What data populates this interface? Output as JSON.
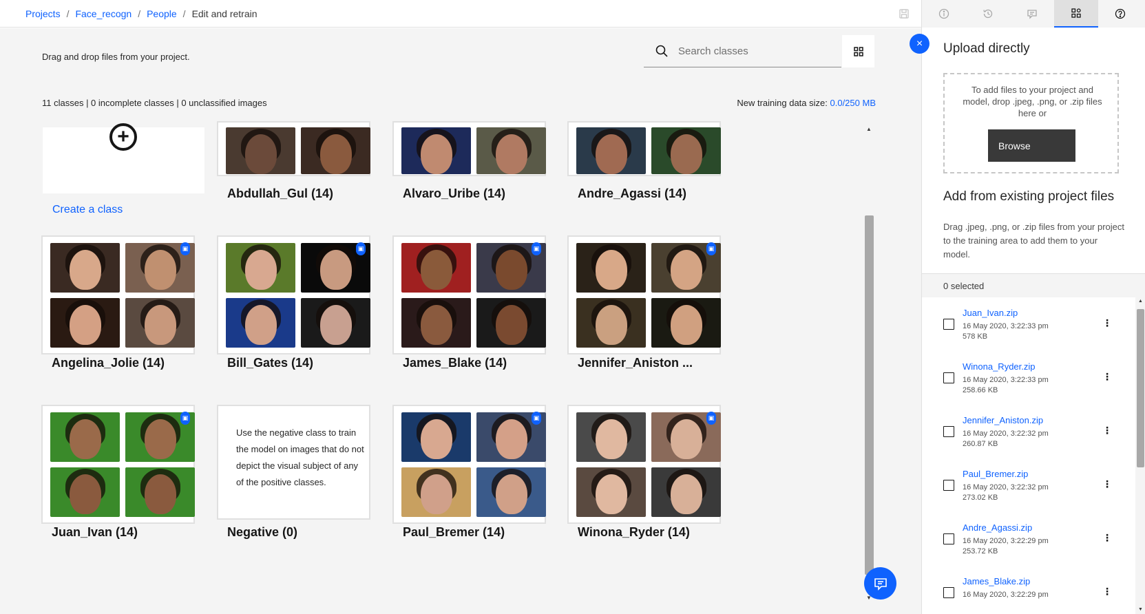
{
  "breadcrumb": {
    "items": [
      "Projects",
      "Face_recogn",
      "People"
    ],
    "separator": "/",
    "current": "Edit and retrain"
  },
  "toolbar": {
    "drag_hint": "Drag and drop files from your project.",
    "search_placeholder": "Search classes",
    "stats": "11 classes | 0 incomplete classes | 0 unclassified images",
    "datasize_label": "New training data size:",
    "datasize_value": "0.0/250 MB"
  },
  "create_class": {
    "label": "Create a class"
  },
  "classes": [
    {
      "label": "Abdullah_Gul (14)",
      "locked": false,
      "tones": [
        "#6b4a3a",
        "#8a5a3e"
      ],
      "bg": [
        "#4a3a30",
        "#3b2a22"
      ]
    },
    {
      "label": "Alvaro_Uribe (14)",
      "locked": false,
      "tones": [
        "#c08a70",
        "#b07a62"
      ],
      "bg": [
        "#1d2a5a",
        "#5a5a48"
      ]
    },
    {
      "label": "Andre_Agassi (14)",
      "locked": false,
      "tones": [
        "#a06a52",
        "#9a6a50"
      ],
      "bg": [
        "#2a3a4a",
        "#2a4a2a"
      ]
    },
    {
      "label": "Angelina_Jolie (14)",
      "locked": true,
      "tones": [
        "#d8a88a",
        "#c09070",
        "#d4a084",
        "#c8987c"
      ],
      "bg": [
        "#3a2a22",
        "#7a6050",
        "#2a1a12",
        "#5a4a40"
      ]
    },
    {
      "label": "Bill_Gates (14)",
      "locked": true,
      "tones": [
        "#d8a890",
        "#c89a80",
        "#d0a088",
        "#c8a090"
      ],
      "bg": [
        "#5a7a2a",
        "#0a0a0a",
        "#1a3a8a",
        "#1a1a1a"
      ]
    },
    {
      "label": "James_Blake (14)",
      "locked": true,
      "tones": [
        "#8a5a3a",
        "#7a4a2e",
        "#8a5a3e",
        "#7a4a30"
      ],
      "bg": [
        "#a02020",
        "#3a3a4a",
        "#2a1a1a",
        "#1a1a1a"
      ]
    },
    {
      "label": "Jennifer_Aniston ...",
      "locked": true,
      "tones": [
        "#d8a888",
        "#d4a484",
        "#caa080",
        "#d0a080"
      ],
      "bg": [
        "#2a2218",
        "#4a4030",
        "#3a3020",
        "#1a1a12"
      ]
    },
    {
      "label": "Juan_Ivan (14)",
      "locked": true,
      "tones": [
        "#9a6a4a",
        "#9a6a4a",
        "#8a5a3e",
        "#8a5a3e"
      ],
      "bg": [
        "#3a8a2a",
        "#3a8a2a",
        "#3a8a2a",
        "#3a8a2a"
      ]
    },
    {
      "label": "Negative (0)",
      "negative": true,
      "text": "Use the negative class to train the model on images that do not depict the visual subject of any of the positive classes."
    },
    {
      "label": "Paul_Bremer (14)",
      "locked": true,
      "tones": [
        "#d8a890",
        "#d4a088",
        "#d0a08a",
        "#d0a088"
      ],
      "bg": [
        "#1a3a6a",
        "#3a4a6a",
        "#c8a060",
        "#3a5a8a"
      ]
    },
    {
      "label": "Winona_Ryder (14)",
      "locked": true,
      "tones": [
        "#e0b8a0",
        "#d8b098",
        "#e0b8a0",
        "#d8b098"
      ],
      "bg": [
        "#4a4a4a",
        "#8a6a5a",
        "#5a4a40",
        "#3a3a3a"
      ]
    }
  ],
  "right_tabs": [
    {
      "icon": "info-icon",
      "active": false
    },
    {
      "icon": "history-icon",
      "active": false
    },
    {
      "icon": "comment-icon",
      "active": false
    },
    {
      "icon": "data-icon",
      "active": true
    },
    {
      "icon": "help-icon",
      "active": false
    }
  ],
  "panel": {
    "close_icon": "×",
    "upload_title": "Upload directly",
    "drop_text": "To add files to your project and model, drop .jpeg, .png, or .zip files here or",
    "browse_label": "Browse",
    "existing_title": "Add from existing project files",
    "existing_desc": "Drag .jpeg, .png, or .zip files from your project to the training area to add them to your model.",
    "selected": "0 selected",
    "files": [
      {
        "name": "Juan_Ivan.zip",
        "date": "16 May 2020, 3:22:33 pm",
        "size": "578 KB"
      },
      {
        "name": "Winona_Ryder.zip",
        "date": "16 May 2020, 3:22:33 pm",
        "size": "258.66 KB"
      },
      {
        "name": "Jennifer_Aniston.zip",
        "date": "16 May 2020, 3:22:32 pm",
        "size": "260.87 KB"
      },
      {
        "name": "Paul_Bremer.zip",
        "date": "16 May 2020, 3:22:32 pm",
        "size": "273.02 KB"
      },
      {
        "name": "Andre_Agassi.zip",
        "date": "16 May 2020, 3:22:29 pm",
        "size": "253.72 KB"
      },
      {
        "name": "James_Blake.zip",
        "date": "16 May 2020, 3:22:29 pm",
        "size": ""
      }
    ]
  },
  "colors": {
    "accent": "#0f62fe",
    "background": "#f4f4f4",
    "browse_button": "#393939"
  }
}
